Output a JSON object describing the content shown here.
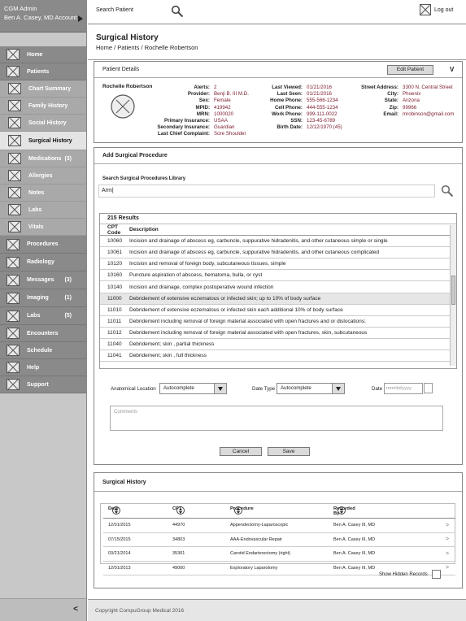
{
  "account": {
    "role": "CGM Admin",
    "name": "Ben A. Casey, MD Account"
  },
  "nav": {
    "home": "Home",
    "patients": "Patients",
    "chart_summary": "Chart Summary",
    "family_history": "Family History",
    "social_history": "Social History",
    "surgical_history": "Surgical History",
    "medications": "Medications",
    "medications_count": "(3)",
    "allergies": "Allergies",
    "notes": "Notes",
    "labs_sub": "Labs",
    "vitals": "Vitals",
    "procedures": "Procedures",
    "radiology": "Radiology",
    "messages": "Messages",
    "messages_count": "(3)",
    "imaging": "Imaging",
    "imaging_count": "(1)",
    "labs": "Labs",
    "labs_count": "(5)",
    "encounters": "Encounters",
    "schedule": "Schedule",
    "help": "Help",
    "support": "Support",
    "collapse": "<"
  },
  "topbar": {
    "search_label": "Search Patient",
    "logout": "Log out"
  },
  "page": {
    "title": "Surgical History",
    "breadcrumb": "Home / Patients / Rochelle Robertson"
  },
  "patient": {
    "panel_title": "Patient Details",
    "edit_button": "Edit Patient",
    "collapse_glyph": "V",
    "name": "Rochelle Robertson",
    "col1": [
      {
        "k": "Alerts:",
        "v": "2"
      },
      {
        "k": "Provider:",
        "v": "Benji B. III M.D."
      },
      {
        "k": "Sex:",
        "v": "Female"
      },
      {
        "k": "MPID:",
        "v": "419942"
      },
      {
        "k": "MRN:",
        "v": "1000020"
      },
      {
        "k": "Primary Insurance:",
        "v": "USAA"
      },
      {
        "k": "Secondary Insurance:",
        "v": "Guardian"
      },
      {
        "k": "Last Chief Complaint:",
        "v": "Sore Shoulder"
      }
    ],
    "col2": [
      {
        "k": "Last Viewed:",
        "v": "01/21/2016"
      },
      {
        "k": "Last Seen:",
        "v": "01/21/2016"
      },
      {
        "k": "Home Phone:",
        "v": "555-566-1234"
      },
      {
        "k": "Cell Phone:",
        "v": "444-555-1234"
      },
      {
        "k": "Work Phone:",
        "v": "999-111-0022"
      },
      {
        "k": "SSN:",
        "v": "123-45-6789"
      },
      {
        "k": "Birth Date:",
        "v": "12/12/1970 (45)"
      }
    ],
    "col3": [
      {
        "k": "Street Address:",
        "v": "3300 N. Central Street"
      },
      {
        "k": "City:",
        "v": "Phoenix"
      },
      {
        "k": "State:",
        "v": "Arizona"
      },
      {
        "k": "Zip:",
        "v": "99966"
      },
      {
        "k": "Email:",
        "v": "mrobinson@gmail.com"
      }
    ]
  },
  "add_procedure": {
    "title": "Add Surgical Procedure",
    "library_label": "Search Surgical Procedures Library",
    "search_value": "Arm|",
    "results_label": "215 Results",
    "col_code": "CPT Code",
    "col_desc": "Description",
    "rows": [
      {
        "code": "10060",
        "desc": "Incision and drainage of abscess eg, carbuncle, suppurative hidradenitis, and other cutaneous simple or single"
      },
      {
        "code": "10061",
        "desc": "Incision and drainage of abscess eg, carbuncle, suppurative hidradenitis, and other cutaneous complicated"
      },
      {
        "code": "10120",
        "desc": "Incision and removal of foreign body, subcutaneous tissues, simple"
      },
      {
        "code": "10160",
        "desc": "Puncture aspiration of abscess, hematoma, bulla, or cyst"
      },
      {
        "code": "10140",
        "desc": "Incision and drainage, complex postoperative wound infection"
      },
      {
        "code": "11000",
        "desc": "Debridement of extensive eczematous or infected skin; up to 10% of body surface"
      },
      {
        "code": "11010",
        "desc": "Debridement of extensive eczematous or infected skin each additional 10% of body surface"
      },
      {
        "code": "11011",
        "desc": "Debridement including removal of foreign material associated with open fractures and or dislocations;"
      },
      {
        "code": "11012",
        "desc": "Debridement including removal of foreign material associated with open fractures, skin, subcutaneous"
      },
      {
        "code": "11040",
        "desc": "Debridement; skin , partial thickness"
      },
      {
        "code": "11041",
        "desc": "Debridement; skin , full thickness"
      }
    ],
    "anatomical_label": "Anatomical Location",
    "anatomical_value": "Autocomplete",
    "date_type_label": "Date Type",
    "date_type_value": "Autocomplete",
    "date_label": "Date",
    "date_placeholder": "mm/dd/yyyy",
    "comments_placeholder": "Comments",
    "cancel": "Cancel",
    "save": "Save"
  },
  "history": {
    "title": "Surgical History",
    "col_date": "Date",
    "col_cpt": "CPT",
    "col_procedure": "Procedure",
    "col_recorded": "Recorded By",
    "rows": [
      {
        "date": "12/01/2015",
        "cpt": "44970",
        "procedure": "Appendectomy-Laparoscopic",
        "by": "Ben A. Casey III, MD"
      },
      {
        "date": "07/15/2015",
        "cpt": "34803",
        "procedure": "AAA-Endovascular Repair",
        "by": "Ben A. Casey III, MD"
      },
      {
        "date": "03/21/2014",
        "cpt": "35301",
        "procedure": "Carotid Endarterectomy (right)",
        "by": "Ben A. Casey III, MD"
      },
      {
        "date": "12/01/2013",
        "cpt": "49000",
        "procedure": "Exploratory Laparotomy",
        "by": "Ben A. Casey III, MD"
      }
    ],
    "row_chevron": ">",
    "show_hidden": "Show Hidden Records"
  },
  "footer": "Copyright CompuGroup Medical 2016"
}
